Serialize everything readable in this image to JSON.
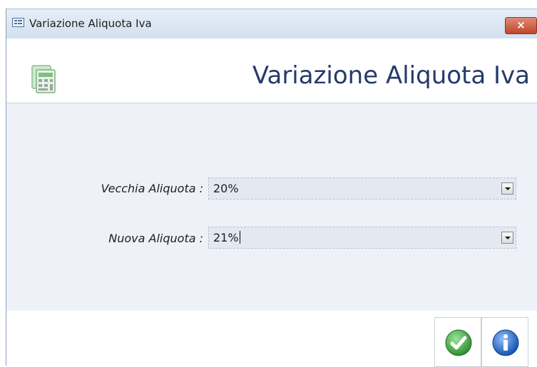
{
  "window": {
    "title": "Variazione Aliquota Iva",
    "close_glyph": "×",
    "app_icon": "form-window-icon"
  },
  "header": {
    "title": "Variazione Aliquota Iva",
    "icon": "calculator-document-icon"
  },
  "form": {
    "old_rate": {
      "label": "Vecchia Aliquota :",
      "value": "20%"
    },
    "new_rate": {
      "label": "Nuova Aliquota :",
      "value": "21%"
    }
  },
  "actions": {
    "confirm_icon": "checkmark-icon",
    "info_icon": "info-icon"
  },
  "colors": {
    "title_text": "#253a6b",
    "content_bg": "#eef2f8",
    "close_button": "#c0452a",
    "confirm_green": "#3aa83a",
    "info_blue": "#1e63c7"
  }
}
